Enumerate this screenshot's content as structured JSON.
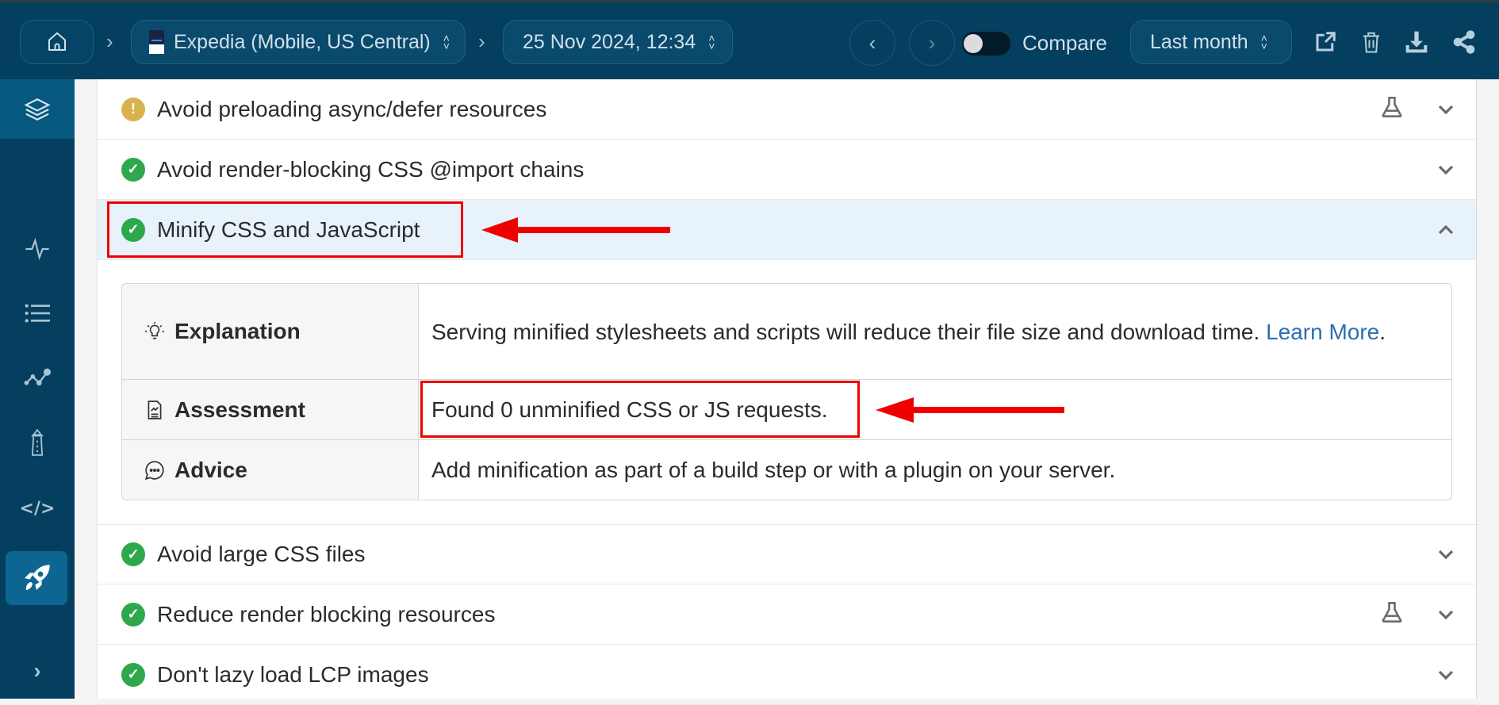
{
  "topbar": {
    "home_icon": "home-icon",
    "site_selector": {
      "label": "Expedia (Mobile, US Central)",
      "thumbnail": "site-thumbnail"
    },
    "date_selector": {
      "label": "25 Nov 2024, 12:34"
    },
    "prev_icon": "chevron-left-icon",
    "next_icon": "chevron-right-icon",
    "compare": {
      "label": "Compare",
      "enabled": false
    },
    "range_selector": {
      "label": "Last month"
    },
    "actions": [
      "external-link-icon",
      "trash-icon",
      "download-icon",
      "share-icon"
    ]
  },
  "sidebar": {
    "items": [
      {
        "icon": "layers-icon",
        "active": true
      },
      {
        "icon": "pulse-icon",
        "active": false
      },
      {
        "icon": "list-icon",
        "active": false
      },
      {
        "icon": "trend-icon",
        "active": false
      },
      {
        "icon": "lighthouse-icon",
        "active": false
      },
      {
        "icon": "code-icon",
        "active": false
      },
      {
        "icon": "search-chart-icon",
        "active": false
      },
      {
        "icon": "rocket-icon",
        "active": true
      }
    ],
    "expand_icon": "chevron-right-icon"
  },
  "audits": [
    {
      "title": "Avoid preloading async/defer resources",
      "status": "warning",
      "experimental": true,
      "expanded": false
    },
    {
      "title": "Avoid render-blocking CSS @import chains",
      "status": "pass",
      "experimental": false,
      "expanded": false
    },
    {
      "title": "Minify CSS and JavaScript",
      "status": "pass",
      "experimental": false,
      "expanded": true
    },
    {
      "title": "Avoid large CSS files",
      "status": "pass",
      "experimental": false,
      "expanded": false
    },
    {
      "title": "Reduce render blocking resources",
      "status": "pass",
      "experimental": true,
      "expanded": false
    },
    {
      "title": "Don't lazy load LCP images",
      "status": "pass",
      "experimental": false,
      "expanded": false
    }
  ],
  "details": {
    "explanation": {
      "label": "Explanation",
      "text": "Serving minified stylesheets and scripts will reduce their file size and download time.",
      "link": "Learn More",
      "suffix": "."
    },
    "assessment": {
      "label": "Assessment",
      "text": "Found 0 unminified CSS or JS requests."
    },
    "advice": {
      "label": "Advice",
      "text": "Add minification as part of a build step or with a plugin on your server."
    }
  },
  "colors": {
    "topbar_bg": "#043f5f",
    "pass": "#2ea84a",
    "warning": "#d9b24d",
    "link": "#2c6fb3",
    "annotation": "#ee0000",
    "active_row": "#e8f2fb"
  }
}
